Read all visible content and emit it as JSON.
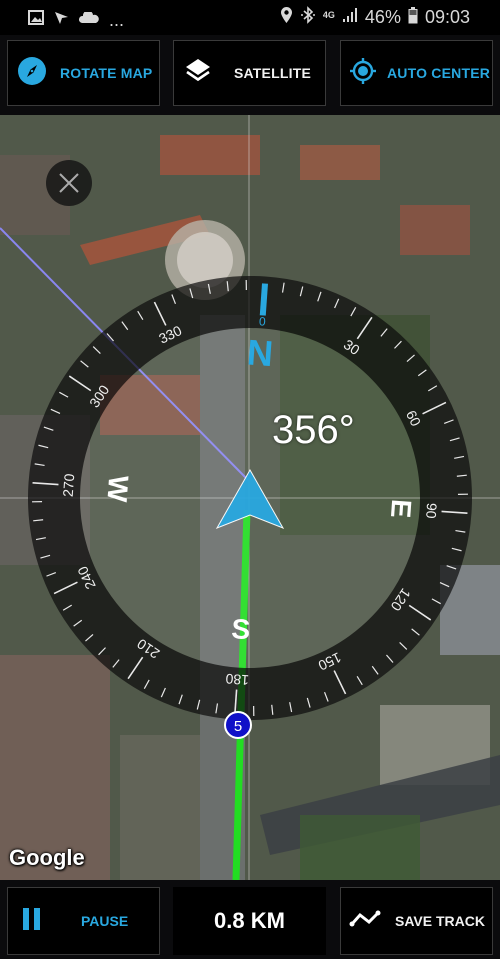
{
  "status_bar": {
    "left_icons": [
      "gallery-icon",
      "navigation-arrow-icon",
      "cloud-icon",
      "more-notifications-icon"
    ],
    "more": "...",
    "right_icons": [
      "location-pin-icon",
      "bluetooth-icon",
      "4g-icon",
      "signal-icon"
    ],
    "network": "4G",
    "battery": "46%",
    "time": "09:03"
  },
  "toolbar": {
    "rotate_map": "ROTATE MAP",
    "satellite": "SATELLITE",
    "auto_center": "AUTO CENTER"
  },
  "compass": {
    "heading": "356°",
    "heading_value": 356,
    "cardinals": {
      "n": "N",
      "e": "E",
      "s": "S",
      "w": "W"
    },
    "degree_labels": [
      "0",
      "30",
      "60",
      "90",
      "120",
      "150",
      "180",
      "210",
      "240",
      "270",
      "300",
      "330"
    ]
  },
  "map": {
    "attribution": "Google",
    "waypoint_label": "5"
  },
  "bottom_bar": {
    "pause": "PAUSE",
    "distance": "0.8 KM",
    "save_track": "SAVE TRACK"
  },
  "colors": {
    "accent": "#29a8e0",
    "track": "#22dd22",
    "bearing_line": "#8a86f0",
    "waypoint": "#1010c8"
  }
}
